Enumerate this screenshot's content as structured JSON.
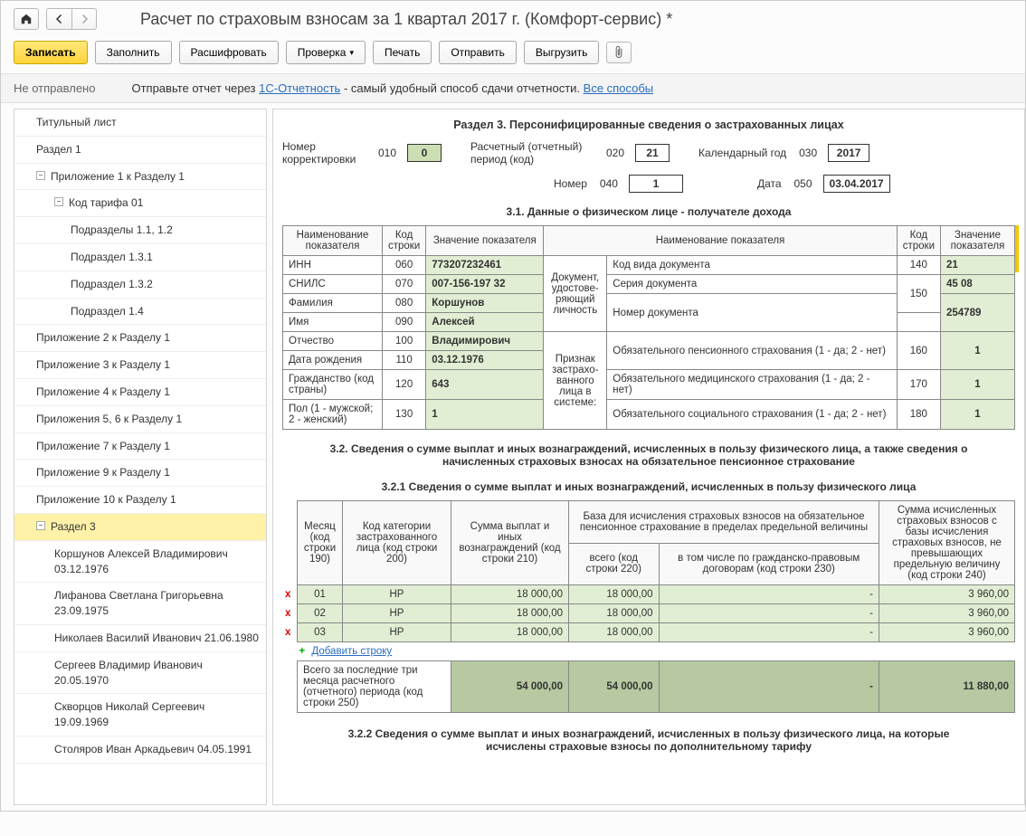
{
  "title": "Расчет по страховым взносам за 1 квартал 2017 г. (Комфорт-сервис) *",
  "toolbar": {
    "write": "Записать",
    "fill": "Заполнить",
    "decode": "Расшифровать",
    "check": "Проверка",
    "print": "Печать",
    "send": "Отправить",
    "export": "Выгрузить"
  },
  "status": {
    "state": "Не отправлено",
    "hint_before": "Отправьте отчет через ",
    "hint_link1": "1С-Отчетность",
    "hint_mid": " - самый удобный способ сдачи отчетности. ",
    "hint_link2": "Все способы"
  },
  "sidebar": [
    {
      "label": "Титульный лист",
      "level": 1
    },
    {
      "label": "Раздел 1",
      "level": 1
    },
    {
      "label": "Приложение 1 к Разделу 1",
      "level": 1,
      "expand": "−"
    },
    {
      "label": "Код тарифа 01",
      "level": 2,
      "expand": "−"
    },
    {
      "label": "Подразделы 1.1, 1.2",
      "level": 3
    },
    {
      "label": "Подраздел 1.3.1",
      "level": 3
    },
    {
      "label": "Подраздел 1.3.2",
      "level": 3
    },
    {
      "label": "Подраздел 1.4",
      "level": 3
    },
    {
      "label": "Приложение 2 к Разделу 1",
      "level": 1
    },
    {
      "label": "Приложение 3 к Разделу 1",
      "level": 1
    },
    {
      "label": "Приложение 4 к Разделу 1",
      "level": 1
    },
    {
      "label": "Приложения 5, 6 к Разделу 1",
      "level": 1
    },
    {
      "label": "Приложение 7 к Разделу 1",
      "level": 1
    },
    {
      "label": "Приложение 9 к Разделу 1",
      "level": 1
    },
    {
      "label": "Приложение 10 к Разделу 1",
      "level": 1
    },
    {
      "label": "Раздел 3",
      "level": 1,
      "expand": "−",
      "selected": true
    },
    {
      "label": "Коршунов Алексей Владимирович 03.12.1976",
      "level": 2
    },
    {
      "label": "Лифанова Светлана Григорьевна 23.09.1975",
      "level": 2
    },
    {
      "label": "Николаев Василий Иванович 21.06.1980",
      "level": 2
    },
    {
      "label": "Сергеев Владимир Иванович 20.05.1970",
      "level": 2
    },
    {
      "label": "Скворцов Николай Сергеевич 19.09.1969",
      "level": 2
    },
    {
      "label": "Столяров Иван Аркадьевич 04.05.1991",
      "level": 2
    }
  ],
  "section3": {
    "title": "Раздел 3. Персонифицированные сведения о застрахованных лицах",
    "row1": {
      "corr_label": "Номер корректировки",
      "corr_code": "010",
      "corr_val": "0",
      "period_label": "Расчетный (отчетный) период (код)",
      "period_code": "020",
      "period_val": "21",
      "year_label": "Календарный год",
      "year_code": "030",
      "year_val": "2017"
    },
    "row2": {
      "num_label": "Номер",
      "num_code": "040",
      "num_val": "1",
      "date_label": "Дата",
      "date_code": "050",
      "date_val": "03.04.2017"
    },
    "s31_title": "3.1. Данные о физическом лице - получателе дохода",
    "s31_head": {
      "c1": "Наименование показателя",
      "c2": "Код строки",
      "c3": "Значение показателя",
      "c4": "Наименование показателя",
      "c5": "Код строки",
      "c6": "Значение показателя"
    },
    "s31": {
      "inn_l": "ИНН",
      "inn_c": "060",
      "inn_v": "773207232461",
      "snils_l": "СНИЛС",
      "snils_c": "070",
      "snils_v": "007-156-197 32",
      "fam_l": "Фамилия",
      "fam_c": "080",
      "fam_v": "Коршунов",
      "name_l": "Имя",
      "name_c": "090",
      "name_v": "Алексей",
      "otch_l": "Отчество",
      "otch_c": "100",
      "otch_v": "Владимирович",
      "dob_l": "Дата рождения",
      "dob_c": "110",
      "dob_v": "03.12.1976",
      "cit_l": "Гражданство (код страны)",
      "cit_c": "120",
      "cit_v": "643",
      "sex_l": "Пол (1 - мужской; 2 - женский)",
      "sex_c": "130",
      "sex_v": "1",
      "doc_group": "Документ, удостове-ряющий личность",
      "doctype_l": "Код вида документа",
      "doctype_c": "140",
      "doctype_v": "21",
      "docser_l": "Серия документа",
      "docser_c": "150",
      "docser_v": "45 08",
      "docnum_l": "Номер документа",
      "docnum_v": "254789",
      "sign_group": "Признак застрахо-ванного лица в системе:",
      "pens_l": "Обязательного пенсионного страхования (1 - да; 2 - нет)",
      "pens_c": "160",
      "pens_v": "1",
      "med_l": "Обязательного медицинского страхования (1 - да; 2 - нет)",
      "med_c": "170",
      "med_v": "1",
      "soc_l": "Обязательного социального страхования (1 - да; 2 - нет)",
      "soc_c": "180",
      "soc_v": "1"
    },
    "s32_title": "3.2. Сведения о сумме выплат и иных вознаграждений, исчисленных в пользу физического лица, а также сведения о начисленных страховых взносах на обязательное пенсионное страхование",
    "s321_title": "3.2.1 Сведения о сумме выплат и иных вознаграждений, исчисленных в пользу физического лица",
    "s321_head": {
      "month": "Месяц (код строки 190)",
      "cat": "Код категории застрахованного лица (код строки 200)",
      "sum": "Сумма выплат и иных вознаграждений (код строки 210)",
      "base_top": "База для исчисления страховых взносов на обязательное пенсионное страхование в пределах предельной величины",
      "base_all": "всего (код строки 220)",
      "base_gpd": "в том числе по гражданско-правовым договорам (код строки 230)",
      "contrib": "Сумма исчисленных страховых взносов с базы исчисления страховых взносов, не превышающих предельную величину (код строки 240)"
    },
    "s321_rows": [
      {
        "x": "x",
        "m": "01",
        "cat": "НР",
        "sum": "18 000,00",
        "base": "18 000,00",
        "gpd": "-",
        "contr": "3 960,00"
      },
      {
        "x": "x",
        "m": "02",
        "cat": "НР",
        "sum": "18 000,00",
        "base": "18 000,00",
        "gpd": "-",
        "contr": "3 960,00"
      },
      {
        "x": "x",
        "m": "03",
        "cat": "НР",
        "sum": "18 000,00",
        "base": "18 000,00",
        "gpd": "-",
        "contr": "3 960,00"
      }
    ],
    "add_row": "Добавить строку",
    "s321_total": {
      "label": "Всего за последние три месяца расчетного (отчетного) периода (код строки 250)",
      "sum": "54 000,00",
      "base": "54 000,00",
      "gpd": "-",
      "contr": "11 880,00"
    },
    "s322_title": "3.2.2 Сведения о сумме выплат и иных вознаграждений, исчисленных в пользу физического лица, на которые исчислены страховые взносы по дополнительному тарифу"
  }
}
